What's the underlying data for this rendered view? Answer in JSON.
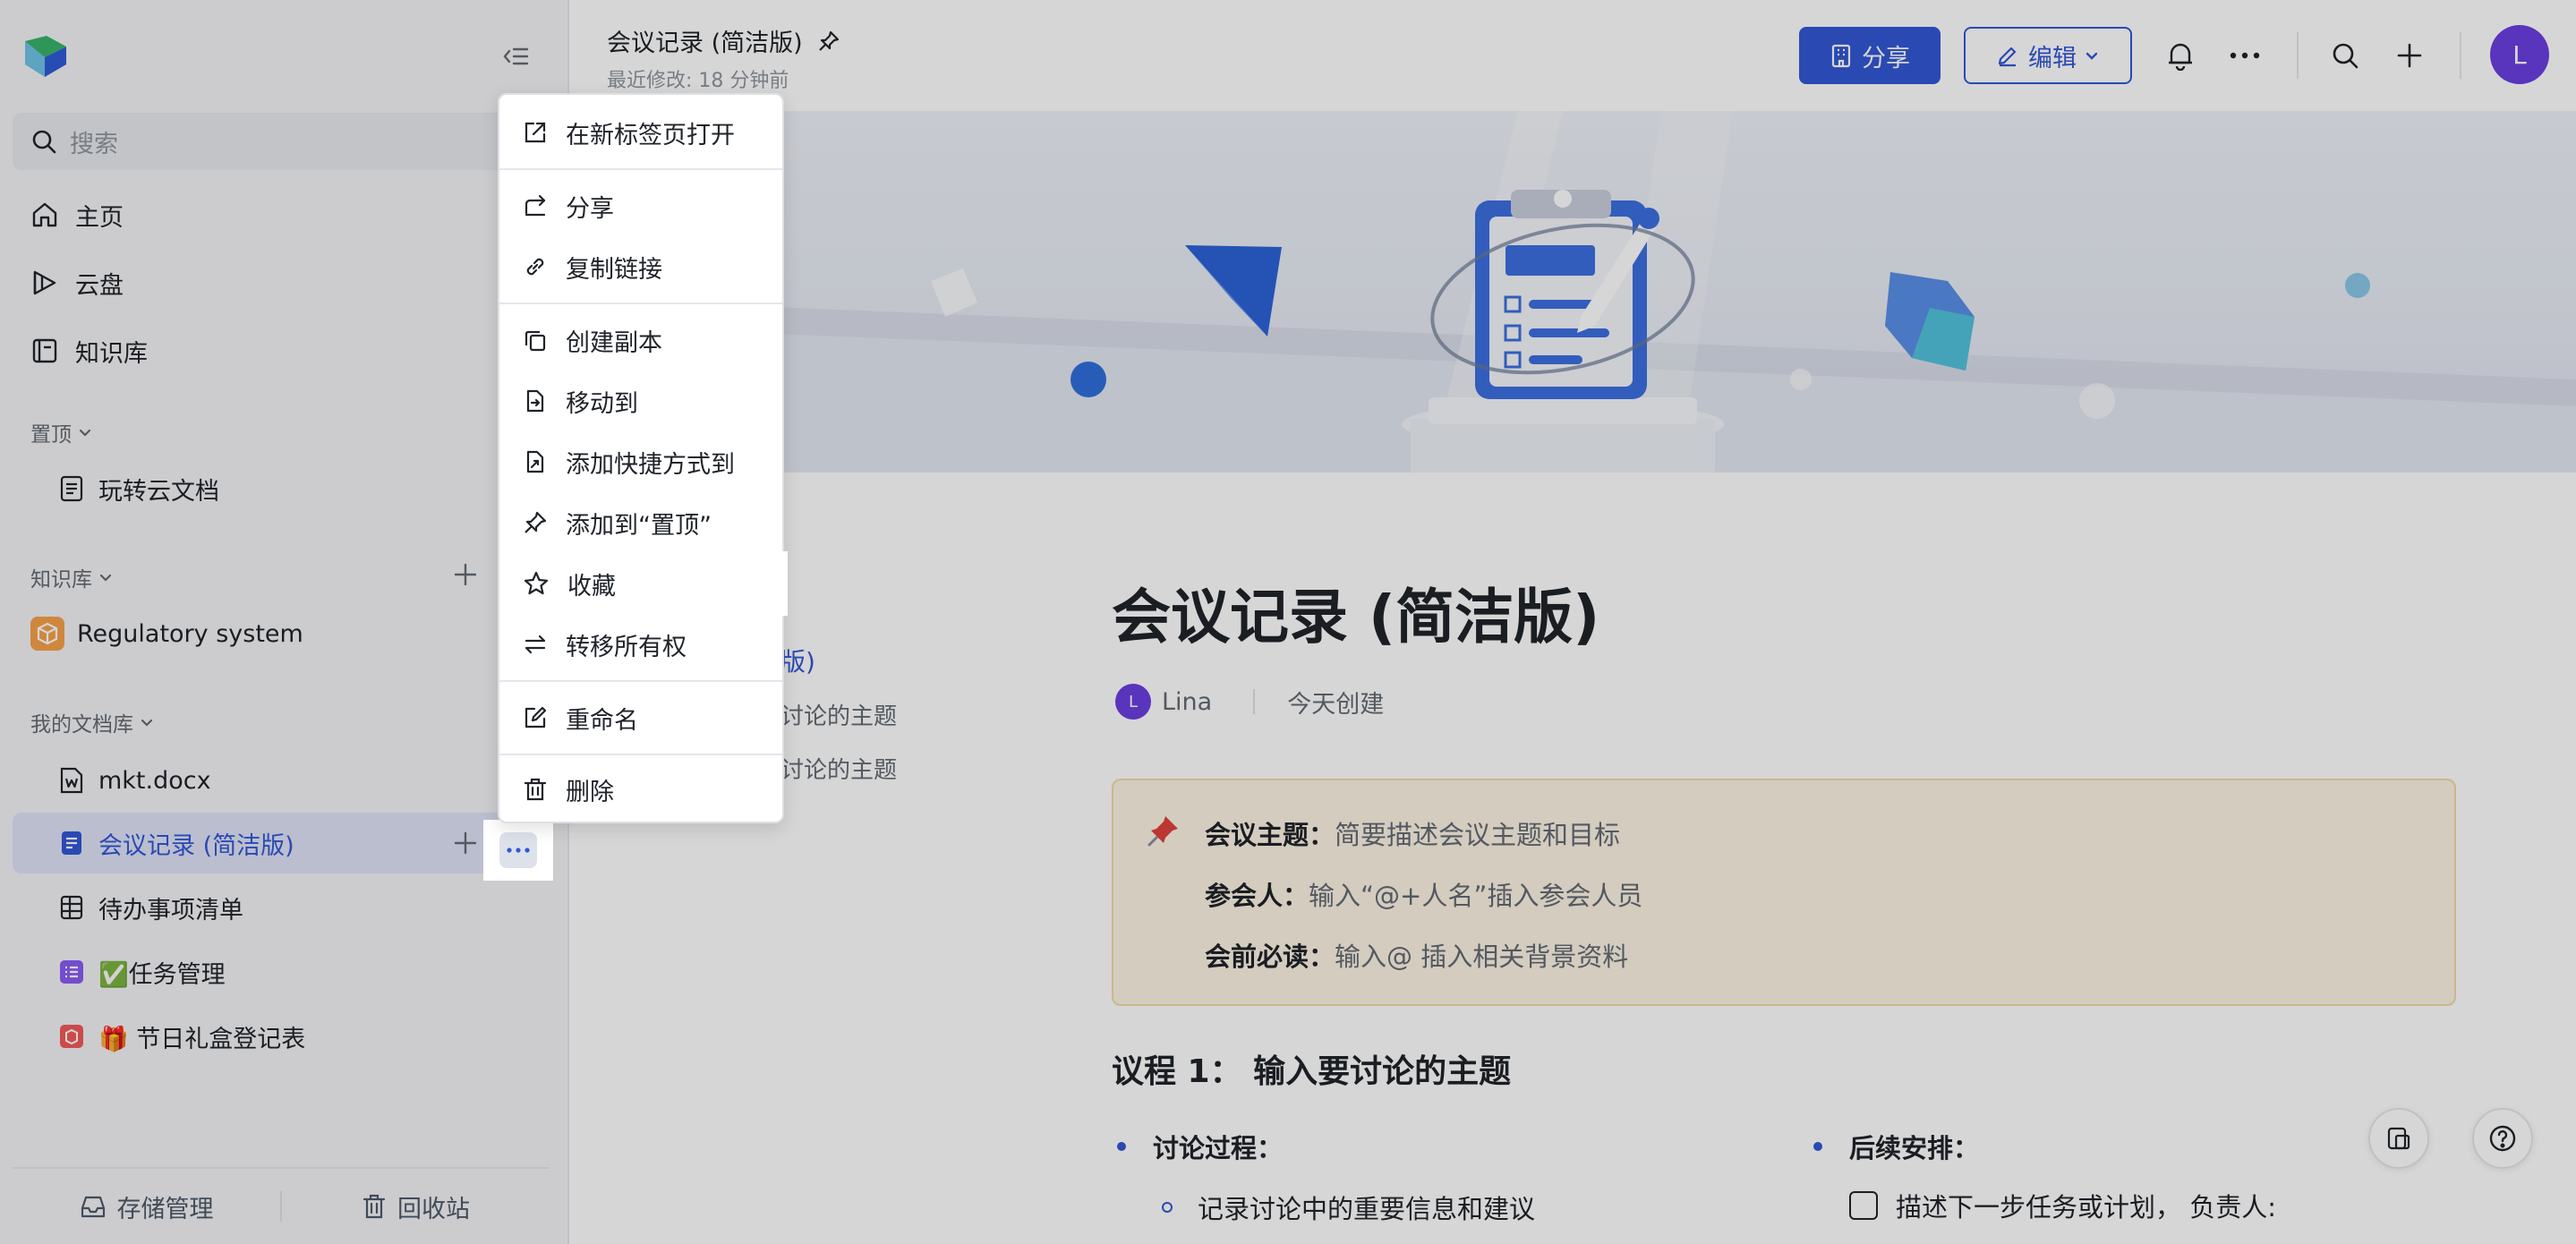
{
  "sidebar": {
    "search_placeholder": "搜索",
    "nav": [
      {
        "label": "主页",
        "icon": "home-icon"
      },
      {
        "label": "云盘",
        "icon": "cloud-drive-icon"
      },
      {
        "label": "知识库",
        "icon": "knowledge-base-icon"
      }
    ],
    "pinned": {
      "title": "置顶",
      "items": [
        {
          "label": "玩转云文档",
          "icon": "doc-icon"
        }
      ]
    },
    "knowledge": {
      "title": "知识库",
      "items": [
        {
          "label": "Regulatory system",
          "icon": "cube-icon"
        }
      ]
    },
    "mydocs": {
      "title": "我的文档库",
      "items": [
        {
          "label": "mkt.docx",
          "icon": "word-file-icon"
        },
        {
          "label": "会议记录 (简洁版)",
          "icon": "doc-icon",
          "active": true
        },
        {
          "label": "待办事项清单",
          "icon": "sheet-icon"
        },
        {
          "label": "✅任务管理",
          "icon": "task-list-icon"
        },
        {
          "label": "🎁 节日礼盒登记表",
          "icon": "form-icon"
        }
      ]
    },
    "footer": {
      "storage": "存储管理",
      "trash": "回收站"
    }
  },
  "header": {
    "title": "会议记录 (简洁版)",
    "subtitle": "最近修改: 18 分钟前",
    "share_label": "分享",
    "edit_label": "编辑",
    "avatar_initial": "L"
  },
  "context_menu": {
    "items": [
      {
        "label": "在新标签页打开",
        "icon": "open-external-icon"
      },
      {
        "label": "分享",
        "icon": "share-icon"
      },
      {
        "label": "复制链接",
        "icon": "link-icon"
      },
      {
        "label": "创建副本",
        "icon": "copy-icon"
      },
      {
        "label": "移动到",
        "icon": "move-to-icon"
      },
      {
        "label": "添加快捷方式到",
        "icon": "shortcut-icon"
      },
      {
        "label": "添加到“置顶”",
        "icon": "pin-icon"
      },
      {
        "label": "收藏",
        "icon": "star-icon",
        "highlighted": true
      },
      {
        "label": "转移所有权",
        "icon": "transfer-icon"
      },
      {
        "label": "重命名",
        "icon": "rename-icon"
      },
      {
        "label": "删除",
        "icon": "trash-icon"
      }
    ]
  },
  "outline": {
    "item1": "版)",
    "item2": "讨论的主题",
    "item3": "讨论的主题"
  },
  "document": {
    "heading": "会议记录 (简洁版)",
    "author_initial": "L",
    "author": "Lina",
    "created": "今天创建",
    "callout": {
      "topic_label": "会议主题",
      "topic_value": "简要描述会议主题和目标",
      "attendees_label": "参会人",
      "attendees_value": "输入“@+人名”插入参会人员",
      "reading_label": "会前必读",
      "reading_value": "输入@ 插入相关背景资料"
    },
    "agenda1": "议程 1：  输入要讨论的主题",
    "discussion_label": "讨论过程",
    "discussion_item": "记录讨论中的重要信息和建议",
    "followup_label": "后续安排",
    "followup_item": "描述下一步任务或计划，  负责人:"
  },
  "colors": {
    "accent": "#3357d6",
    "avatar": "#6b3fe0",
    "callout_bg": "#fdf3e4"
  }
}
